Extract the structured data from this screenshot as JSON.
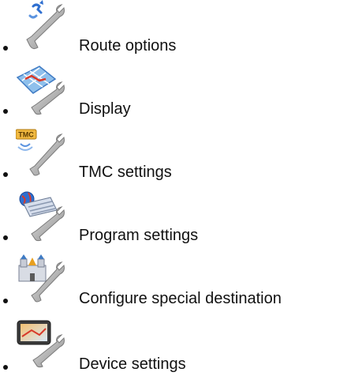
{
  "settings_menu": {
    "items": [
      {
        "label": "Route options",
        "icon": "route-options-icon"
      },
      {
        "label": "Display",
        "icon": "display-icon"
      },
      {
        "label": "TMC settings",
        "icon": "tmc-settings-icon",
        "icon_text": "TMC"
      },
      {
        "label": "Program settings",
        "icon": "program-settings-icon"
      },
      {
        "label": "Configure special destination",
        "icon": "special-destination-icon"
      },
      {
        "label": "Device settings",
        "icon": "device-settings-icon"
      }
    ]
  },
  "colors": {
    "text": "#111111",
    "wrench": "#9a9a9a",
    "map_blue": "#6fa8e0",
    "route_red": "#d83a2a",
    "tmc_orange": "#e8a020",
    "globe_blue": "#2f6fd0",
    "keyboard": "#cfd8e8",
    "device_dark": "#3a3a3a"
  }
}
